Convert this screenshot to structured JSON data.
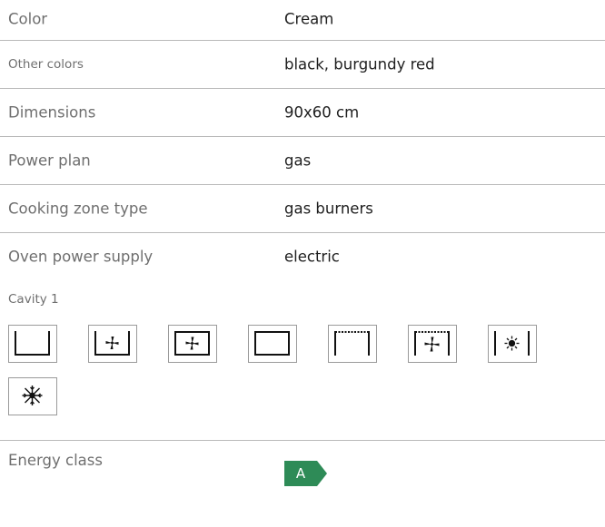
{
  "specs": [
    {
      "label": "Color",
      "value": "Cream"
    },
    {
      "label": "Other colors",
      "value": "black, burgundy red"
    },
    {
      "label": "Dimensions",
      "value": "90x60 cm"
    },
    {
      "label": "Power plan",
      "value": "gas"
    },
    {
      "label": "Cooking zone type",
      "value": "gas burners"
    },
    {
      "label": "Oven power supply",
      "value": "electric"
    }
  ],
  "cavity": {
    "title": "Cavity 1",
    "functions": [
      "bottom-heat-icon",
      "fan-bottom-heat-icon",
      "fan-top-bottom-heat-icon",
      "conventional-heat-icon",
      "top-heat-icon",
      "fan-grill-icon",
      "oven-light-icon",
      "defrost-icon"
    ]
  },
  "energy": {
    "label": "Energy class",
    "class": "A",
    "color": "#2e8b57"
  }
}
